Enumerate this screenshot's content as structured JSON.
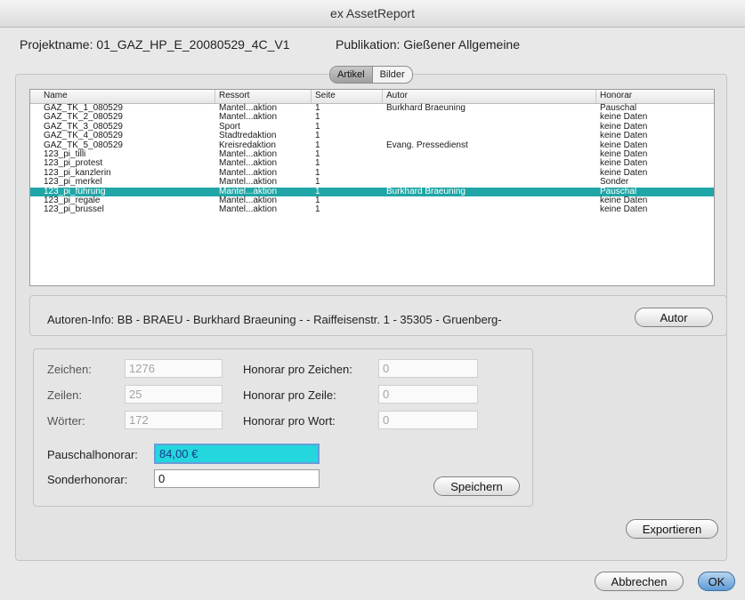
{
  "window": {
    "title": "ex AssetReport"
  },
  "project": {
    "name_text": "Projektname:  01_GAZ_HP_E_20080529_4C_V1",
    "publication_text": "Publikation:  Gießener Allgemeine"
  },
  "tabs": [
    {
      "label": "Artikel",
      "active": true
    },
    {
      "label": "Bilder",
      "active": false
    }
  ],
  "table": {
    "headers": [
      "Name",
      "Ressort",
      "Seite",
      "Autor",
      "Honorar"
    ],
    "rows": [
      [
        "GAZ_TK_1_080529",
        "Mantel...aktion",
        "1",
        "Burkhard Braeuning",
        "Pauschal"
      ],
      [
        "GAZ_TK_2_080529",
        "Mantel...aktion",
        "1",
        "",
        "keine Daten"
      ],
      [
        "GAZ_TK_3_080529",
        "Sport",
        "1",
        "",
        "keine Daten"
      ],
      [
        "GAZ_TK_4_080529",
        "Stadtredaktion",
        "1",
        "",
        "keine Daten"
      ],
      [
        "GAZ_TK_5_080529",
        "Kreisredaktion",
        "1",
        "Evang. Pressedienst",
        "keine Daten"
      ],
      [
        "123_pi_tilli",
        "Mantel...aktion",
        "1",
        "",
        "keine Daten"
      ],
      [
        "123_pi_protest",
        "Mantel...aktion",
        "1",
        "",
        "keine Daten"
      ],
      [
        "123_pi_kanzlerin",
        "Mantel...aktion",
        "1",
        "",
        "keine Daten"
      ],
      [
        "123_pi_merkel",
        "Mantel...aktion",
        "1",
        "",
        "Sonder"
      ],
      [
        "123_pi_führung",
        "Mantel...aktion",
        "1",
        "Burkhard Braeuning",
        "Pauschal"
      ],
      [
        "123_pi_regale",
        "Mantel...aktion",
        "1",
        "",
        "keine Daten"
      ],
      [
        "123_pi_brussel",
        "Mantel...aktion",
        "1",
        "",
        "keine Daten"
      ]
    ],
    "selected_index": 9,
    "selection_color": "#20a6a6"
  },
  "author_info": {
    "text": "Autoren-Info:  BB - BRAEU - Burkhard Braeuning -  - Raiffeisenstr. 1 - 35305 - Gruenberg-",
    "button_label": "Autor"
  },
  "form": {
    "zeichen_label": "Zeichen:",
    "zeichen_value": "1276",
    "zeilen_label": "Zeilen:",
    "zeilen_value": "25",
    "woerter_label": "Wörter:",
    "woerter_value": "172",
    "hpz_label": "Honorar pro Zeichen:",
    "hpz_value": "0",
    "hpzeile_label": "Honorar pro Zeile:",
    "hpzeile_value": "0",
    "hpw_label": "Honorar pro Wort:",
    "hpw_value": "0",
    "pauschal_label": "Pauschalhonorar:",
    "pauschal_value": "84,00 €",
    "sonder_label": "Sonderhonorar:",
    "sonder_value": "0",
    "save_label": "Speichern"
  },
  "buttons": {
    "export_label": "Exportieren",
    "cancel_label": "Abbrechen",
    "ok_label": "OK"
  },
  "colors": {
    "field_highlight": "#24d6dd",
    "default_button": "#5e9ad6"
  }
}
